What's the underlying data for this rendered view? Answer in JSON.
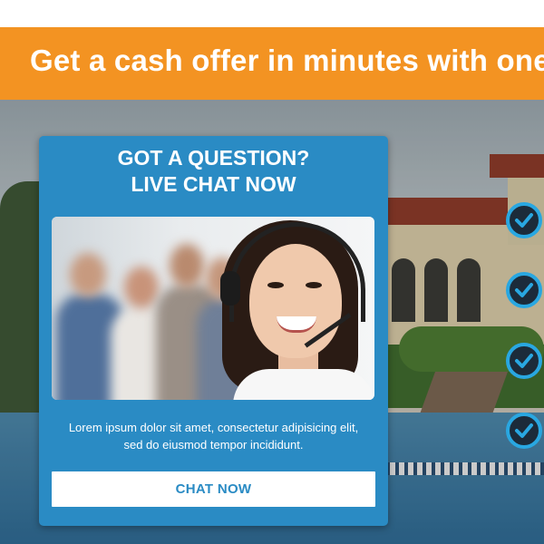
{
  "banner": {
    "headline": "Get a cash offer in minutes with one c"
  },
  "chat_widget": {
    "title_line1": "GOT A QUESTION?",
    "title_line2": "LIVE CHAT NOW",
    "description_line1": "Lorem ipsum dolor sit amet, consectetur adipisicing elit,",
    "description_line2": "sed do eiusmod tempor incididunt.",
    "button_label": "CHAT NOW",
    "photo_icon": "customer-support-agent-photo"
  },
  "checklist": {
    "icon": "check-circle-icon",
    "count_visible": 4
  },
  "colors": {
    "banner_orange": "#f39322",
    "widget_blue": "#2a8bc4",
    "check_blue": "#29a7e1",
    "text_white": "#ffffff"
  }
}
